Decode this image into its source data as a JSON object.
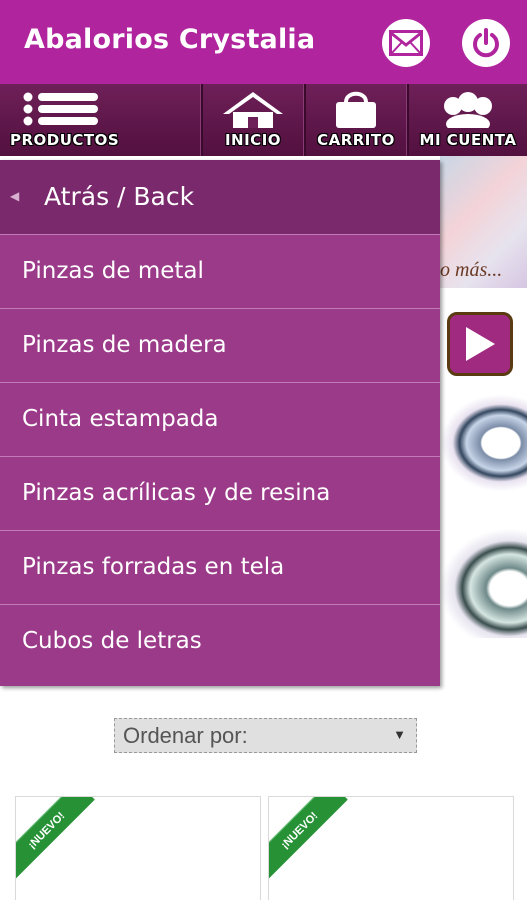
{
  "app": {
    "title": "Abalorios Crystalia"
  },
  "appbar": {
    "mail_icon": "envelope-icon",
    "power_icon": "power-icon"
  },
  "nav": {
    "productos": "PRODUCTOS",
    "inicio": "INICIO",
    "carrito": "CARRITO",
    "micuenta": "MI CUENTA"
  },
  "background": {
    "caption_fragment": "o más..."
  },
  "drawer": {
    "back_label": "Atrás / Back",
    "items": [
      {
        "label": "Pinzas de metal"
      },
      {
        "label": "Pinzas de madera"
      },
      {
        "label": "Cinta estampada"
      },
      {
        "label": "Pinzas acrílicas y de resina"
      },
      {
        "label": "Pinzas forradas en tela"
      },
      {
        "label": "Cubos de letras"
      }
    ]
  },
  "sort": {
    "label": "Ordenar por:"
  },
  "products": [
    {
      "badge": "¡NUEVO!"
    },
    {
      "badge": "¡NUEVO!"
    }
  ],
  "colors": {
    "brand": "#b0249e",
    "navbar": "#5a1446",
    "drawer": "#9a3a88",
    "new_badge": "#279136"
  }
}
